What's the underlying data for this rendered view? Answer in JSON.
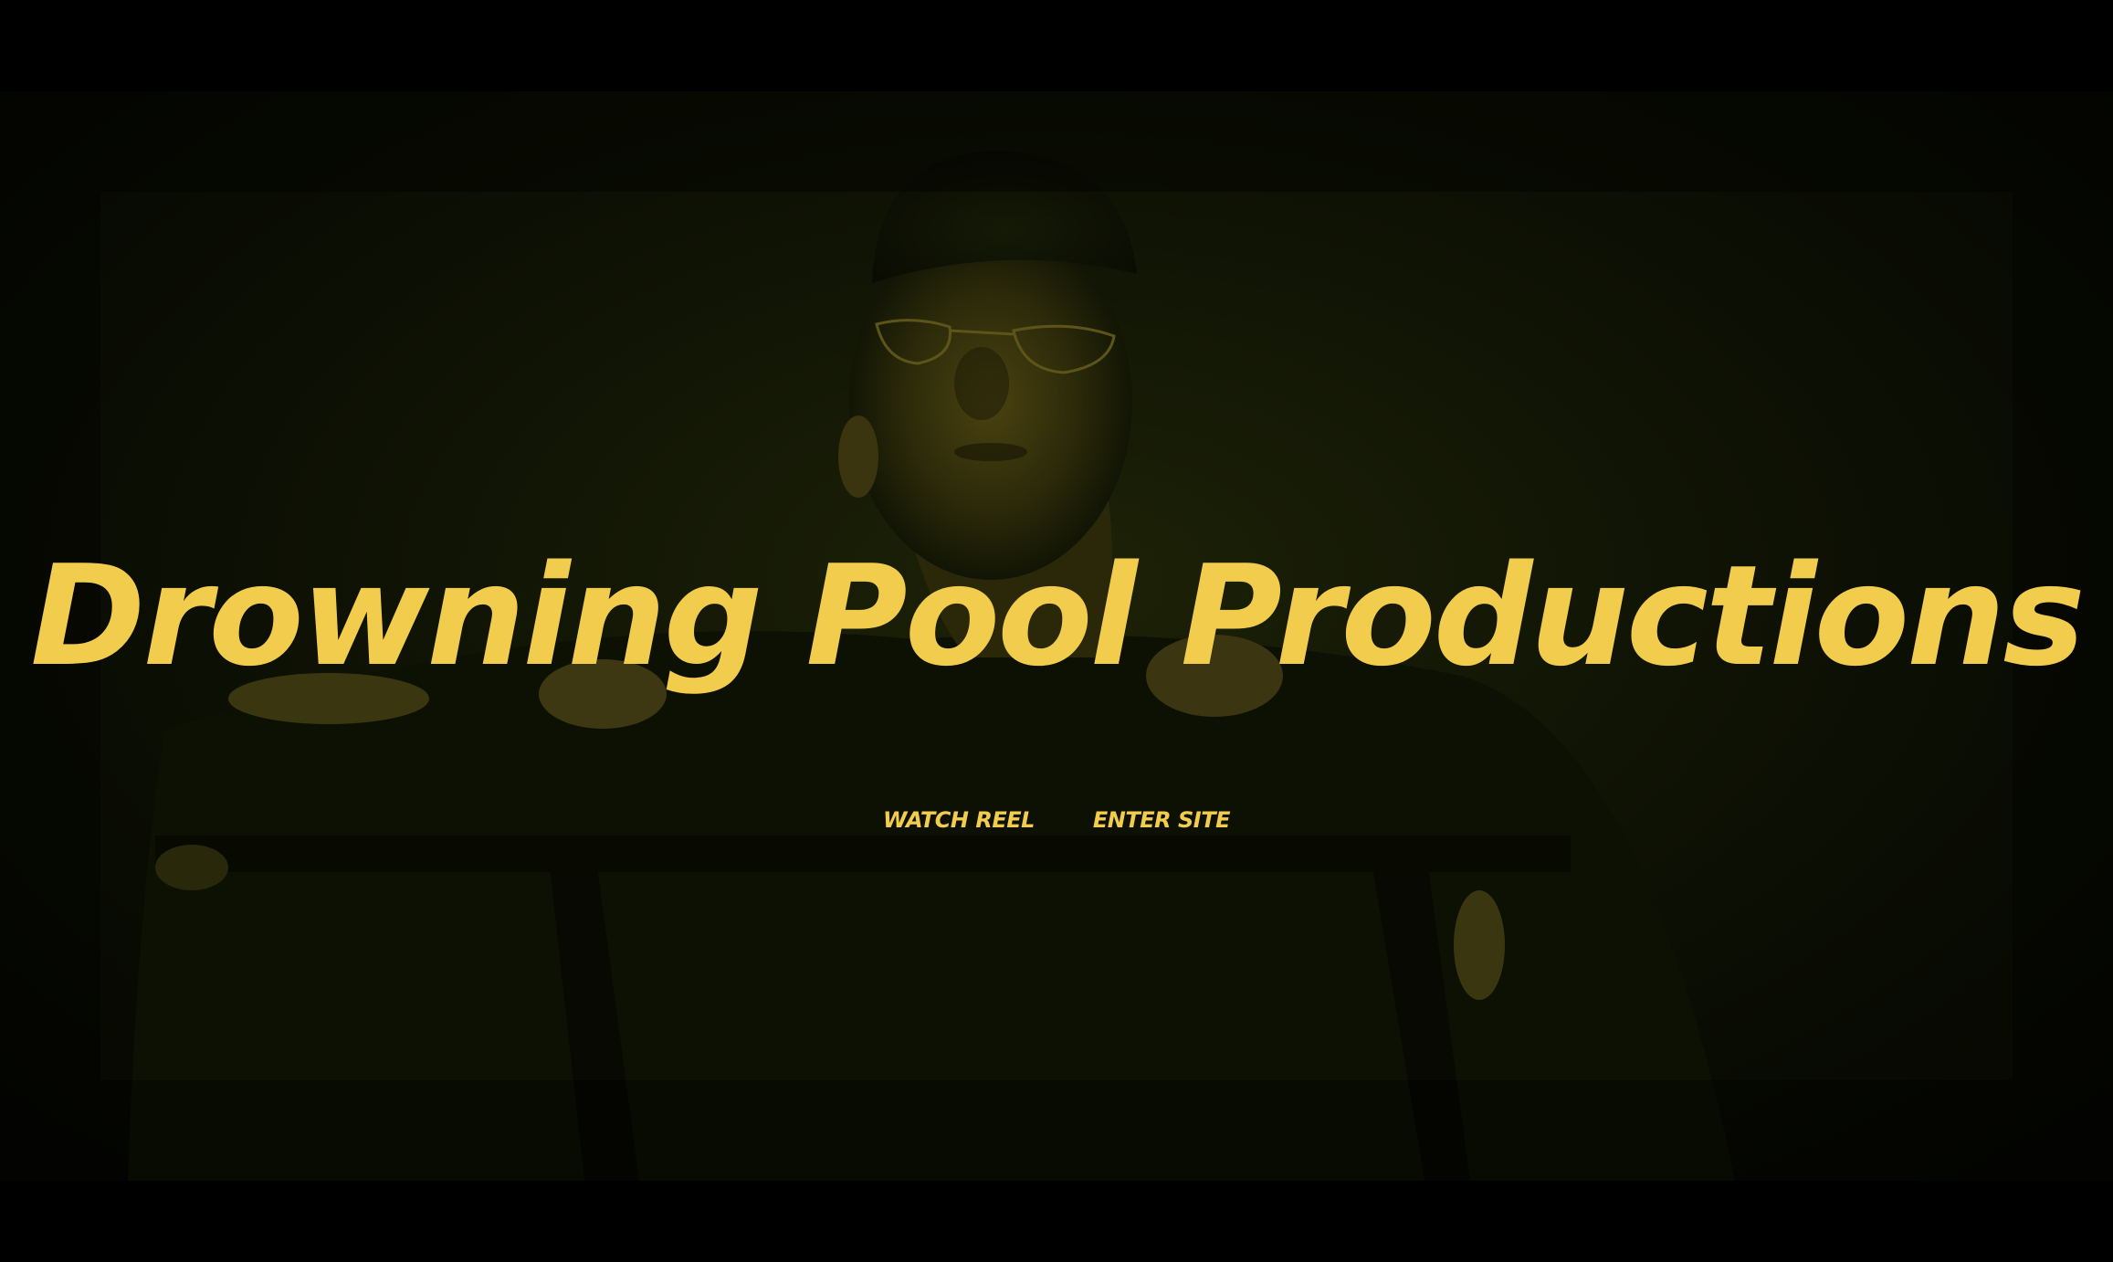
{
  "hero": {
    "title": "Drowning Pool Productions",
    "links": {
      "watch_reel": "WATCH REEL",
      "enter_site": "ENTER SITE"
    }
  },
  "colors": {
    "accent": "#f2cc4c",
    "background": "#000000",
    "video_tint": "#1d2207"
  }
}
